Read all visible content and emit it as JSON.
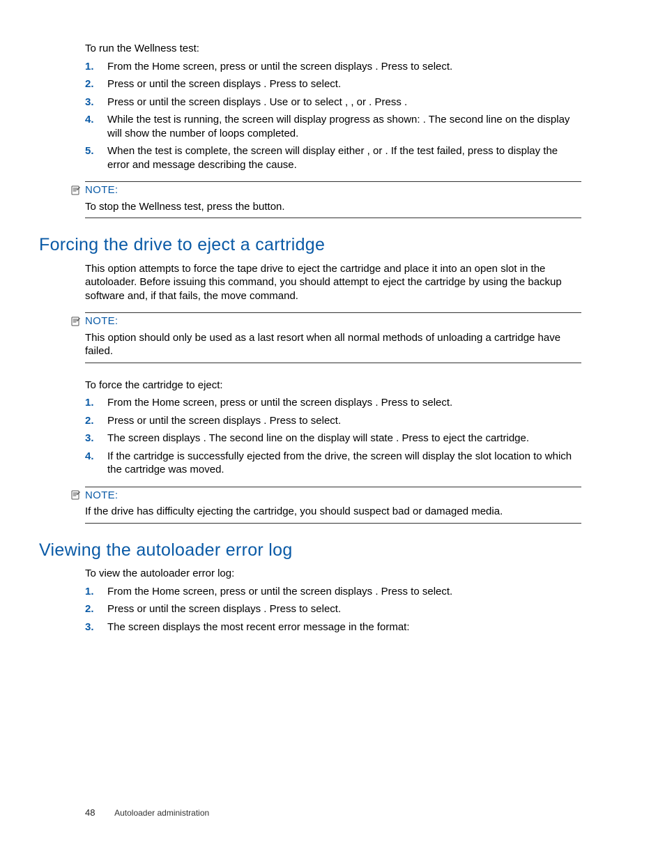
{
  "wellness": {
    "intro": "To run the Wellness test:",
    "steps": [
      "From the Home screen, press                              or                until the screen displays                  . Press              to select.",
      "Press                    or                until the screen displays                                          . Press              to select.",
      "Press                    or                until the screen displays                                                  . Use                or              to select    ,     ,             or                  . Press              .",
      "While the test is running, the screen will display progress as shown:                             . The second line on the display will show the number of loops completed.",
      "When the test is complete, the screen will display either                        , or                              . If the test failed, press              to display the error and message describing the cause."
    ],
    "note_label": "NOTE:",
    "note_body": "To stop the Wellness test, press the                button."
  },
  "forcing": {
    "heading": "Forcing the drive to eject a cartridge",
    "body": "This option attempts to force the tape drive to eject the cartridge and place it into an open slot in the autoloader. Before issuing this command, you should attempt to eject the cartridge by using the backup software and, if that fails, the move command.",
    "note1_label": "NOTE:",
    "note1_body": "This option should only be used as a last resort when all normal methods of unloading a cartridge have failed.",
    "intro2": "To force the cartridge to eject:",
    "steps": [
      "From the Home screen, press                              or                until the screen displays                  . Press              to select.",
      "Press                    or                until the screen displays                                                            . Press              to select.",
      "The screen displays                . The second line on the display will state                                 . Press              to eject the cartridge.",
      "If the cartridge is successfully ejected from the drive, the screen will display the slot location to which the cartridge was moved."
    ],
    "note2_label": "NOTE:",
    "note2_body": "If the drive has difficulty ejecting the cartridge, you should suspect bad or damaged media."
  },
  "errorlog": {
    "heading": "Viewing the autoloader error log",
    "intro": "To view the autoloader error log:",
    "steps": [
      "From the Home screen, press                              or                until the screen displays                  . Press              to select.",
      "Press                    or                until the screen displays                                          . Press              to select.",
      "The screen displays the most recent error message in the format:"
    ]
  },
  "footer": {
    "page_number": "48",
    "chapter": "Autoloader administration"
  }
}
